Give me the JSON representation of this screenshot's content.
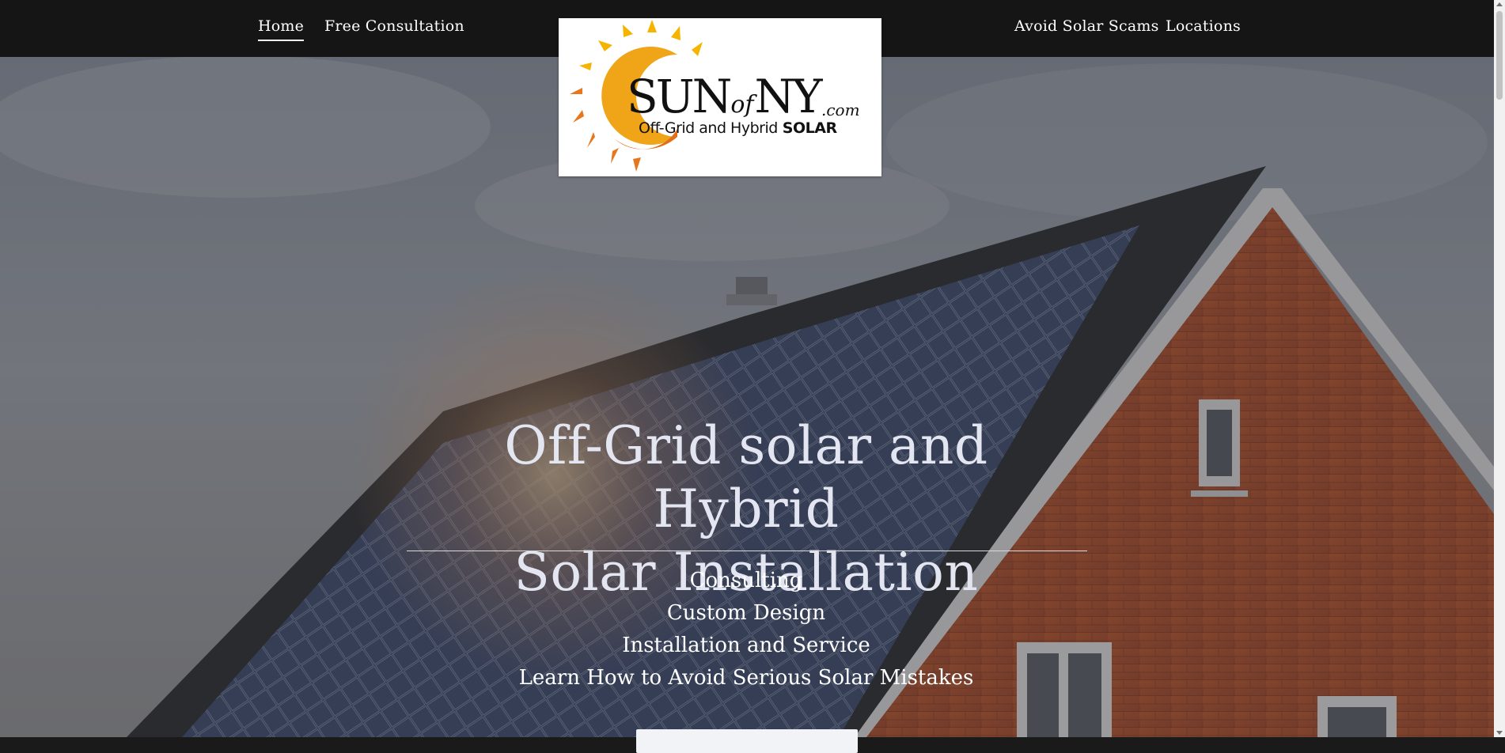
{
  "nav": {
    "left": [
      {
        "label": "Home",
        "active": true
      },
      {
        "label": "Free Consultation",
        "active": false
      }
    ],
    "right": [
      {
        "label": "Avoid Solar Scams"
      },
      {
        "label": "Locations"
      }
    ]
  },
  "logo": {
    "brand_main_1": "SUN",
    "brand_of": "of",
    "brand_main_2": "NY",
    "brand_com": ".com",
    "tagline": "Off-Grid and Hybrid",
    "tagline_bold": "SOLAR",
    "sun_colors": [
      "#f5b400",
      "#e8761b"
    ]
  },
  "hero": {
    "title_line_1": "Off-Grid solar and Hybrid",
    "title_line_2": "Solar Installation",
    "services": [
      "Consulting",
      "Custom Design",
      "Installation and Service",
      "Learn How to Avoid Serious Solar Mistakes"
    ],
    "cta_label": ""
  },
  "colors": {
    "topbar": "#151515",
    "title_text": "#e3e6f1",
    "brick": "#b8552e",
    "roof": "#2f3033",
    "panel": "#3a4a6e"
  }
}
